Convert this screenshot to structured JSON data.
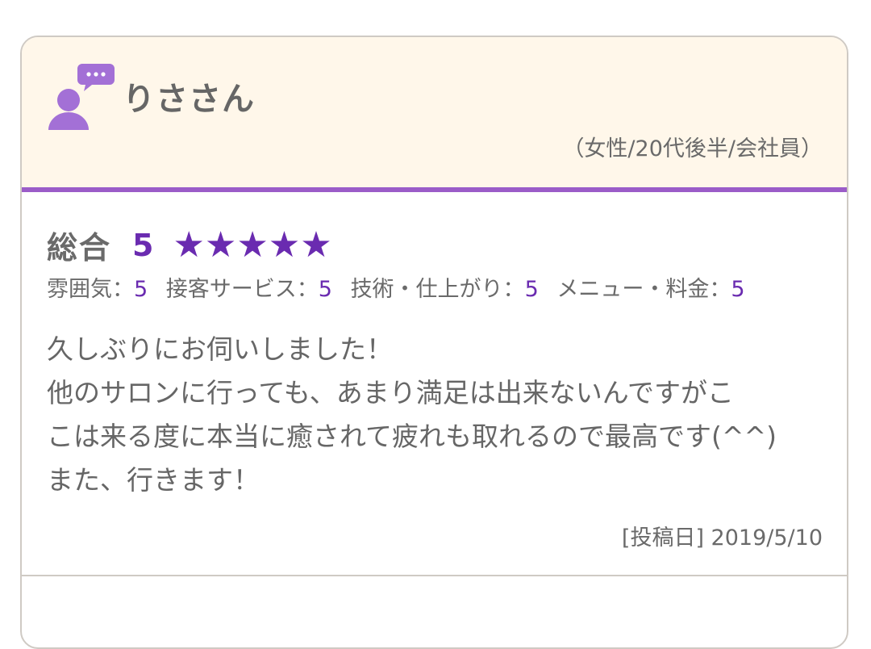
{
  "reviewer": {
    "name": "りささん",
    "profile": "（女性/20代後半/会社員）",
    "avatar_icon": "user-comment-icon"
  },
  "rating": {
    "overall_label": "総合",
    "overall_score": "5",
    "stars": "★★★★★",
    "star_count": 5,
    "star_max": 5,
    "categories": [
      {
        "label": "雰囲気：",
        "value": "5"
      },
      {
        "label": "接客サービス：",
        "value": "5"
      },
      {
        "label": "技術・仕上がり：",
        "value": "5"
      },
      {
        "label": "メニュー・料金：",
        "value": "5"
      }
    ]
  },
  "review": {
    "lines": [
      "久しぶりにお伺いしました！",
      "他のサロンに行っても、あまり満足は出来ないんですがこ",
      "こは来る度に本当に癒されて疲れも取れるので最高です(^^)",
      "また、行きます！"
    ],
    "date": "[投稿日] 2019/5/10"
  },
  "colors": {
    "accent": "#6a2bb0",
    "header_bg": "#fff7ea",
    "header_border": "#9b5cc8",
    "avatar": "#a370d6",
    "text": "#666666"
  }
}
